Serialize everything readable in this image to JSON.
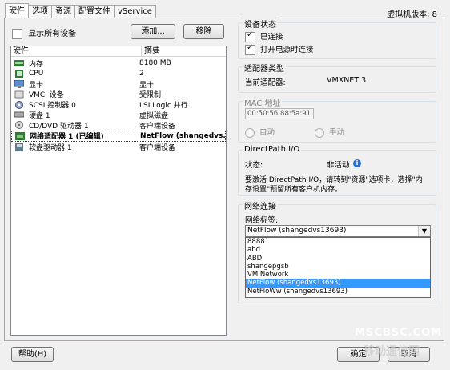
{
  "tabs": [
    "硬件",
    "选项",
    "资源",
    "配置文件",
    "vService"
  ],
  "version_label": "虚拟机版本: 8",
  "show_all_devices": "显示所有设备",
  "buttons": {
    "add": "添加...",
    "remove": "移除",
    "help": "帮助(H)",
    "ok": "确定",
    "cancel": "取消"
  },
  "hardware_list": {
    "headers": [
      "硬件",
      "摘要"
    ],
    "rows": [
      {
        "name": "内存",
        "summary": "8180 MB",
        "icon": "memory-icon"
      },
      {
        "name": "CPU",
        "summary": "2",
        "icon": "cpu-icon"
      },
      {
        "name": "显卡",
        "summary": "显卡",
        "icon": "video-card-icon"
      },
      {
        "name": "VMCI 设备",
        "summary": "受限制",
        "icon": "vmci-device-icon"
      },
      {
        "name": "SCSI 控制器 0",
        "summary": "LSI Logic 并行",
        "icon": "scsi-controller-icon"
      },
      {
        "name": "硬盘 1",
        "summary": "虚拟磁盘",
        "icon": "hard-disk-icon"
      },
      {
        "name": "CD/DVD 驱动器 1",
        "summary": "客户端设备",
        "icon": "cd-dvd-icon"
      },
      {
        "name": "网络适配器 1 (已编辑)",
        "summary": "NetFlow (shangedvs...",
        "icon": "network-adapter-icon",
        "selected": true
      },
      {
        "name": "软盘驱动器 1",
        "summary": "客户端设备",
        "icon": "floppy-drive-icon"
      }
    ]
  },
  "device_status": {
    "title": "设备状态",
    "connected": "已连接",
    "connect_at_power_on": "打开电源时连接"
  },
  "adapter_type": {
    "title": "适配器类型",
    "label": "当前适配器:",
    "value": "VMXNET 3"
  },
  "mac": {
    "title": "MAC 地址",
    "value": "00:50:56:88:5a:91",
    "auto": "自动",
    "manual": "手动"
  },
  "directpath": {
    "title": "DirectPath I/O",
    "status_label": "状态:",
    "status_value": "非活动",
    "note_line1": "要激活 DirectPath I/O，请转到\"资源\"选项卡，选择\"内",
    "note_line2": "存设置\"预留所有客户机内存。"
  },
  "network": {
    "title": "网络连接",
    "label": "网络标签:",
    "selected": "NetFlow (shangedvs13693)",
    "options": [
      "88881",
      "abd",
      "ABD",
      "shangepgsb",
      "VM Network",
      "NetFlow (shangedvs13693)",
      "NetFloWw (shangedvs13693)"
    ],
    "highlighted_index": 5
  },
  "watermark_line1": "MSCBSC.COM",
  "watermark_line2": "移动通信网"
}
